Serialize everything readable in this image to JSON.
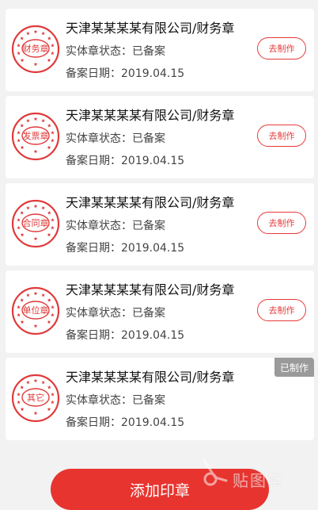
{
  "seals": [
    {
      "seal_text": "财务章",
      "title": "天津某某某某有限公司/财务章",
      "status_line": "实体章状态：已备案",
      "date_line": "备案日期：2019.04.15",
      "action": "去制作"
    },
    {
      "seal_text": "发票章",
      "title": "天津某某某某有限公司/财务章",
      "status_line": "实体章状态：已备案",
      "date_line": "备案日期：2019.04.15",
      "action": "去制作"
    },
    {
      "seal_text": "合同章",
      "title": "天津某某某某有限公司/财务章",
      "status_line": "实体章状态：已备案",
      "date_line": "备案日期：2019.04.15",
      "action": "去制作"
    },
    {
      "seal_text": "单位章",
      "title": "天津某某某某有限公司/财务章",
      "status_line": "实体章状态：已备案",
      "date_line": "备案日期：2019.04.15",
      "action": "去制作"
    },
    {
      "seal_text": "其它",
      "title": "天津某某某某有限公司/财务章",
      "status_line": "实体章状态：已备案",
      "date_line": "备案日期：2019.04.15",
      "badge": "已制作"
    }
  ],
  "footer": {
    "add_label": "添加印章"
  },
  "watermark": {
    "text": "贴图实"
  },
  "colors": {
    "accent": "#e8342f",
    "seal_red": "#e03a3a",
    "badge_gray": "#9a9a9a"
  }
}
